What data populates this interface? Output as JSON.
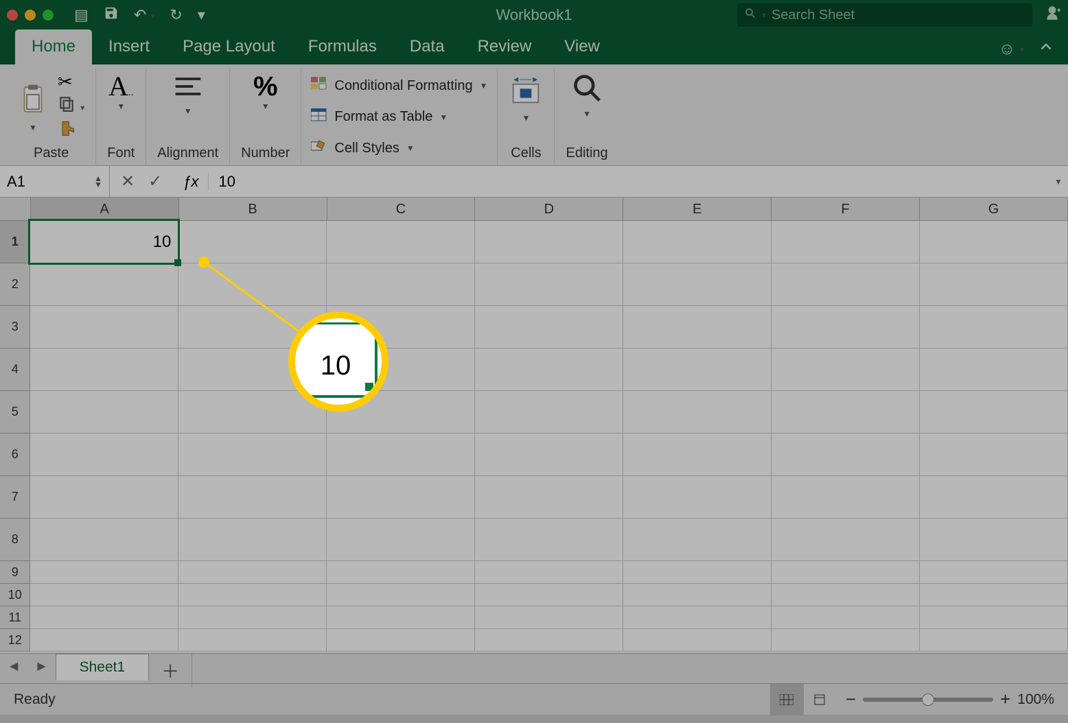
{
  "title": "Workbook1",
  "search": {
    "placeholder": "Search Sheet"
  },
  "tabs": {
    "items": [
      "Home",
      "Insert",
      "Page Layout",
      "Formulas",
      "Data",
      "Review",
      "View"
    ],
    "active": 0
  },
  "ribbon": {
    "paste": "Paste",
    "font": "Font",
    "alignment": "Alignment",
    "number": "Number",
    "cond_fmt": "Conditional Formatting",
    "fmt_table": "Format as Table",
    "cell_styles": "Cell Styles",
    "cells": "Cells",
    "editing": "Editing"
  },
  "formula_bar": {
    "name": "A1",
    "value": "10"
  },
  "grid": {
    "columns": [
      "A",
      "B",
      "C",
      "D",
      "E",
      "F",
      "G"
    ],
    "rows": [
      1,
      2,
      3,
      4,
      5,
      6,
      7,
      8,
      9,
      10,
      11,
      12
    ],
    "primary_row_height": 62,
    "short_row_height": 33,
    "a1_value": "10"
  },
  "sheet_tabs": {
    "active": "Sheet1"
  },
  "status": {
    "ready": "Ready",
    "zoom": "100%"
  },
  "callout": {
    "mag_value": "10"
  }
}
